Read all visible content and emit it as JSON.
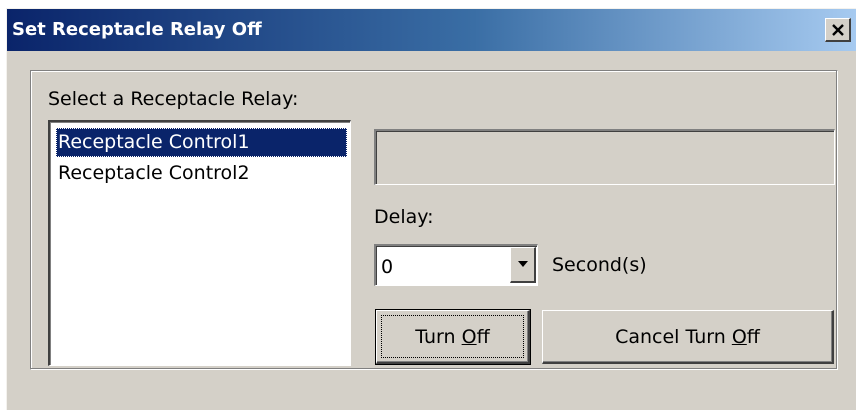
{
  "window": {
    "title": "Set Receptacle Relay Off",
    "close_glyph": "×"
  },
  "group": {
    "label": "Select a Receptacle Relay:"
  },
  "relay_list": {
    "items": [
      {
        "label": "Receptacle Control1",
        "selected": true
      },
      {
        "label": "Receptacle Control2",
        "selected": false
      }
    ]
  },
  "status_box": {
    "value": ""
  },
  "delay": {
    "label": "Delay:",
    "value": "0",
    "unit": "Second(s)"
  },
  "buttons": {
    "turn_off_pre": "Turn ",
    "turn_off_mnemonic": "O",
    "turn_off_post": "ff",
    "cancel_pre": "Cancel Turn ",
    "cancel_mnemonic": "O",
    "cancel_post": "ff"
  },
  "colors": {
    "title_bar_start": "#0a246a",
    "title_bar_end": "#a6caf0",
    "dialog_face": "#d4d0c8",
    "selection": "#0a246a"
  }
}
